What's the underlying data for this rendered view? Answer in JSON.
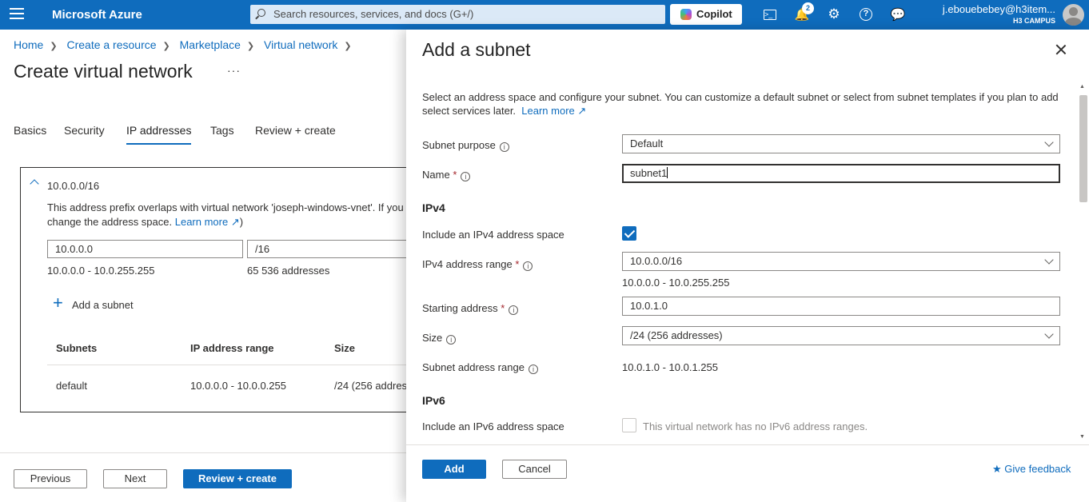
{
  "topbar": {
    "brand": "Microsoft Azure",
    "search_placeholder": "Search resources, services, and docs (G+/)",
    "copilot": "Copilot",
    "notifications_count": "2",
    "user_email": "j.ebouebebey@h3item...",
    "user_org": "H3 CAMPUS"
  },
  "breadcrumb": [
    "Home",
    "Create a resource",
    "Marketplace",
    "Virtual network"
  ],
  "page": {
    "title": "Create virtual network",
    "more": "···",
    "tabs": [
      "Basics",
      "Security",
      "IP addresses",
      "Tags",
      "Review + create"
    ],
    "active_tab": "IP addresses"
  },
  "address_space": {
    "cidr": "10.0.0.0/16",
    "warning": "This address prefix overlaps with virtual network 'joseph-windows-vnet'. If you",
    "warning_line2": "change the address space.",
    "learn_more": "Learn more",
    "learn_more_suffix": ")",
    "address": "10.0.0.0",
    "prefix": "/16",
    "range": "10.0.0.0 - 10.0.255.255",
    "count": "65 536 addresses",
    "add_subnet": "Add a subnet",
    "columns": [
      "Subnets",
      "IP address range",
      "Size"
    ],
    "rows": [
      {
        "name": "default",
        "range": "10.0.0.0 - 10.0.0.255",
        "size": "/24 (256 addres"
      }
    ]
  },
  "footer": {
    "previous": "Previous",
    "next": "Next",
    "review": "Review + create"
  },
  "panel": {
    "title": "Add a subnet",
    "intro": "Select an address space and configure your subnet. You can customize a default subnet or select from subnet templates if you plan to add select services later.",
    "learn_more": "Learn more",
    "subnet_purpose_label": "Subnet purpose",
    "subnet_purpose": "Default",
    "name_label": "Name",
    "name_value": "subnet1",
    "ipv4_heading": "IPv4",
    "include_ipv4_label": "Include an IPv4 address space",
    "include_ipv4": true,
    "ipv4_range_label": "IPv4 address range",
    "ipv4_range": "10.0.0.0/16",
    "ipv4_range_sub": "10.0.0.0 - 10.0.255.255",
    "starting_label": "Starting address",
    "starting": "10.0.1.0",
    "size_label": "Size",
    "size": "/24 (256 addresses)",
    "subnet_range_label": "Subnet address range",
    "subnet_range": "10.0.1.0 - 10.0.1.255",
    "ipv6_heading": "IPv6",
    "include_ipv6_label": "Include an IPv6 address space",
    "include_ipv6": false,
    "ipv6_note": "This virtual network has no IPv6 address ranges.",
    "add": "Add",
    "cancel": "Cancel",
    "feedback": "Give feedback"
  }
}
